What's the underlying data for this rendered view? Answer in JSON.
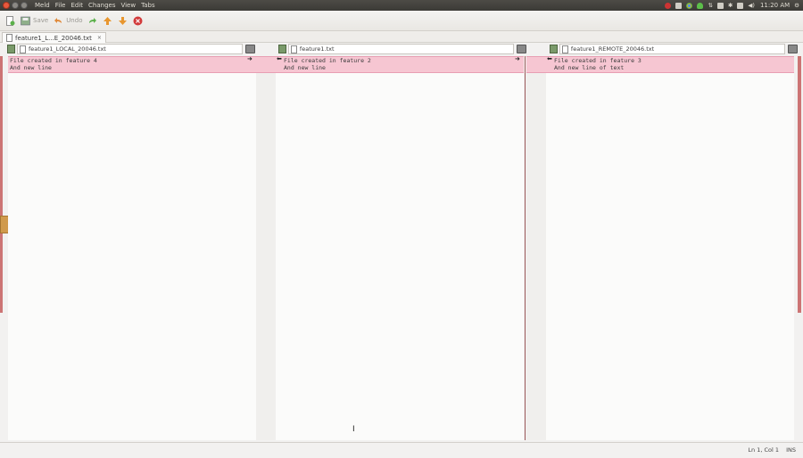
{
  "topbar": {
    "app_name": "Meld",
    "menu": [
      "File",
      "Edit",
      "Changes",
      "View",
      "Tabs"
    ],
    "clock": "11:20 AM"
  },
  "toolbar": {
    "save_label": "Save",
    "undo_label": "Undo"
  },
  "tab": {
    "title": "feature1_L...E_20046.txt"
  },
  "panes": [
    {
      "filename": "feature1_LOCAL_20046.txt",
      "lines": [
        "File created in feature 4",
        "And new line"
      ]
    },
    {
      "filename": "feature1.txt",
      "lines": [
        "File created in feature 2",
        "And new line"
      ]
    },
    {
      "filename": "feature1_REMOTE_20046.txt",
      "lines": [
        "File created in feature 3",
        "And new line of text"
      ]
    }
  ],
  "status": {
    "position": "Ln 1, Col 1",
    "mode": "INS"
  },
  "colors": {
    "conflict": "#f6c6d2",
    "conflict_border": "#e89eb3",
    "marker": "#cc7474"
  }
}
